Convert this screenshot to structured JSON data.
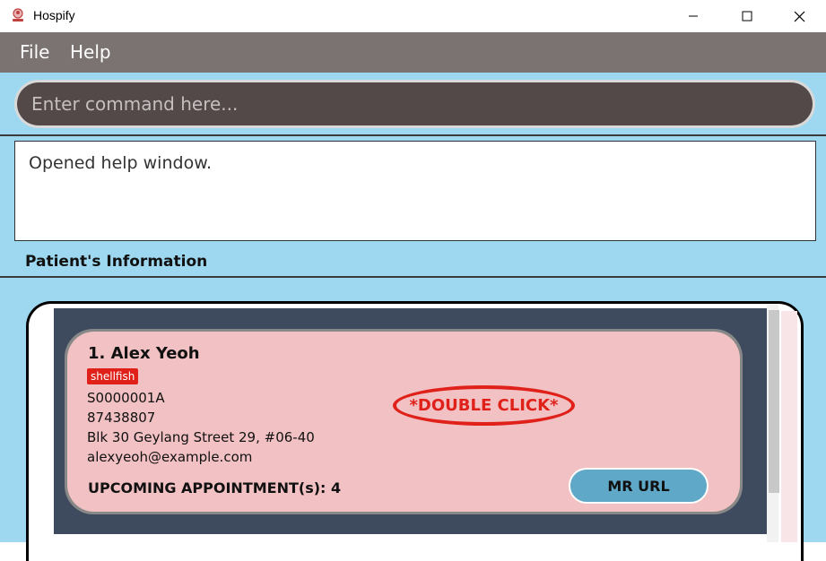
{
  "window": {
    "title": "Hospify",
    "icons": {
      "app": "hospify-logo-icon",
      "minimize": "minimize-icon",
      "maximize": "maximize-icon",
      "close": "close-icon"
    }
  },
  "menu": {
    "items": [
      {
        "label": "File"
      },
      {
        "label": "Help"
      }
    ]
  },
  "command": {
    "placeholder": "Enter command here...",
    "value": ""
  },
  "result": {
    "text": "Opened help window."
  },
  "section": {
    "title": "Patient's Information"
  },
  "patients": [
    {
      "index_name": "1.  Alex Yeoh",
      "tag": "shellfish",
      "nric": "S0000001A",
      "phone": "87438807",
      "address": "Blk 30 Geylang Street 29, #06-40",
      "email": "alexyeoh@example.com",
      "appointments": "UPCOMING APPOINTMENT(s): 4",
      "hint": "*DOUBLE CLICK*",
      "mr_button": "MR URL"
    }
  ],
  "colors": {
    "menubar": "#7a7371",
    "background": "#9ed8f0",
    "command_box": "#544949",
    "card": "#f2c1c3",
    "tag": "#e0211a",
    "mr_button": "#5fa8c8",
    "list_background": "#3e4a5e"
  }
}
